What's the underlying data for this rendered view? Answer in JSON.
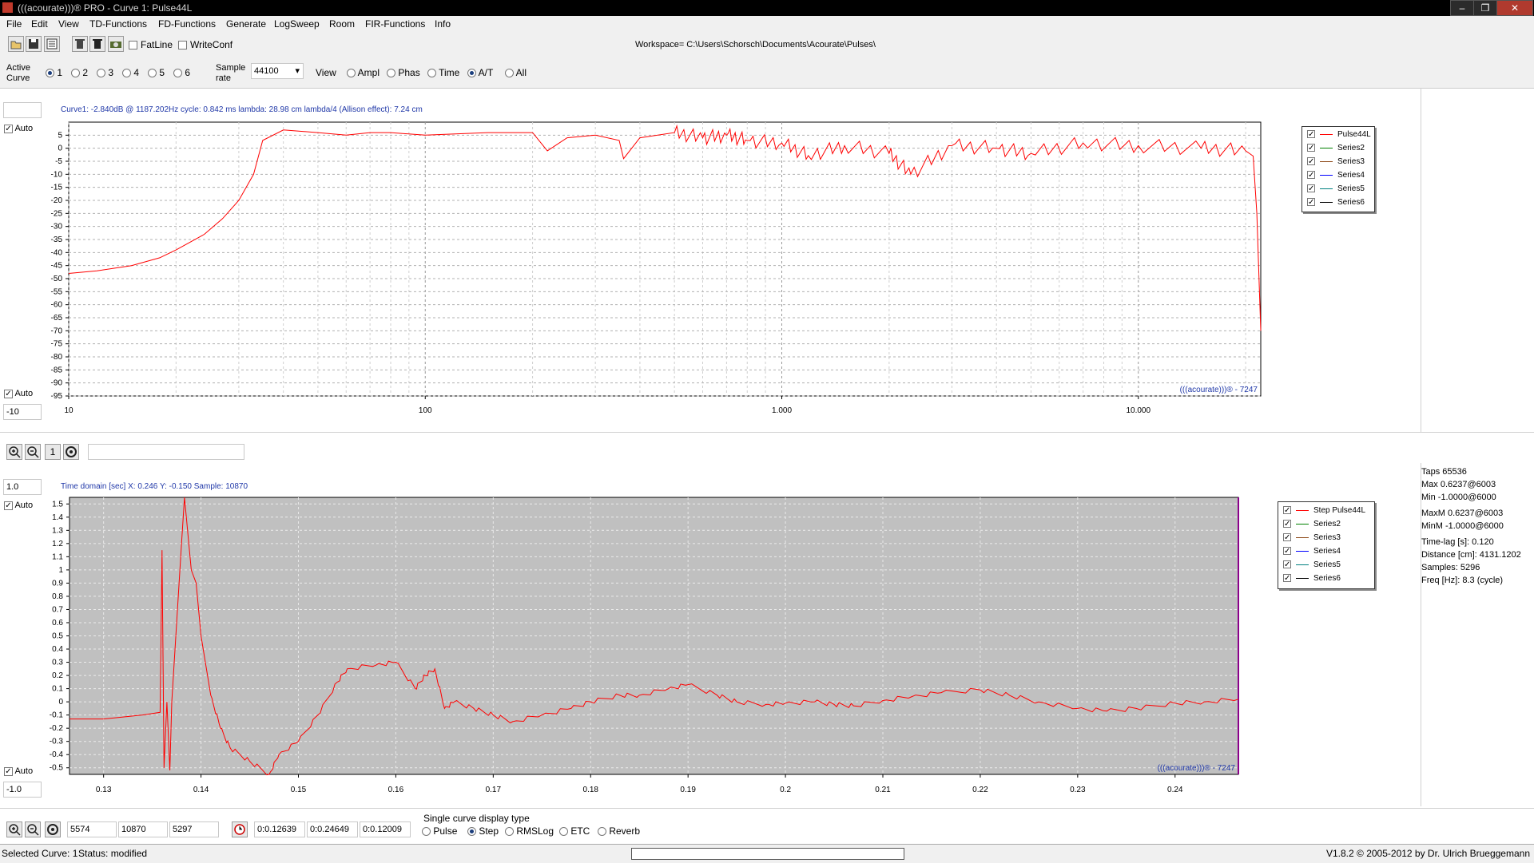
{
  "titlebar": {
    "title": "(((acourate)))® PRO - Curve 1: Pulse44L",
    "min": "–",
    "max": "❐",
    "close": "✕"
  },
  "menu": [
    "File",
    "Edit",
    "View",
    "TD-Functions",
    "FD-Functions",
    "Generate",
    "LogSweep",
    "Room",
    "FIR-Functions",
    "Info"
  ],
  "toolbar": {
    "fatline": "FatLine",
    "writeconf": "WriteConf",
    "workspace": "Workspace= C:\\Users\\Schorsch\\Documents\\Acourate\\Pulses\\"
  },
  "options": {
    "active_curve_label": "Active Curve",
    "curves": [
      "1",
      "2",
      "3",
      "4",
      "5",
      "6"
    ],
    "sample_rate_label": "Sample rate",
    "sample_rate": "44100",
    "view_label": "View",
    "views": [
      "Ampl",
      "Phas",
      "Time",
      "A/T",
      "All"
    ]
  },
  "freq_panel": {
    "info": "Curve1: -2.840dB @ 1187.202Hz   cycle: 0.842 ms   lambda: 28.98 cm   lambda/4 (Allison effect): 7.24 cm",
    "auto_top": "Auto",
    "auto_bottom": "Auto",
    "top_value": "",
    "bottom_value": "-10",
    "watermark": "(((acourate)))® - 7247",
    "legend": [
      "Pulse44L",
      "Series2",
      "Series3",
      "Series4",
      "Series5",
      "Series6"
    ]
  },
  "time_panel": {
    "info": "Time domain [sec]   X: 0.246   Y: -0.150   Sample: 10870",
    "top_value": "1.0",
    "bottom_value": "-1.0",
    "auto_top": "Auto",
    "auto_bottom": "Auto",
    "watermark": "(((acourate)))® - 7247",
    "legend": [
      "Step Pulse44L",
      "Series2",
      "Series3",
      "Series4",
      "Series5",
      "Series6"
    ],
    "zoom_one": "1"
  },
  "stats": [
    "Taps 65536",
    "Max 0.6237@6003",
    "Min -1.0000@6000",
    "MaxM 0.6237@6003",
    "MinM -1.0000@6000",
    "Time-lag [s]: 0.120",
    "Distance [cm]: 4131.1202",
    "Samples:  5296",
    "Freq [Hz]: 8.3 (cycle)"
  ],
  "bottom_controls": {
    "fields": [
      "5574",
      "10870",
      "5297"
    ],
    "times": [
      "0:0.12639",
      "0:0.24649",
      "0:0.12009"
    ],
    "display_type_label": "Single curve display type",
    "display_types": [
      "Pulse",
      "Step",
      "RMSLog",
      "ETC",
      "Reverb"
    ]
  },
  "status": {
    "selected": "Selected Curve: 1",
    "state": "Status: modified",
    "version": "V1.8.2 © 2005-2012 by Dr. Ulrich Brueggemann"
  },
  "colors": {
    "curve": "#ff0000",
    "series2": "#008000",
    "series3": "#8b4513",
    "series4": "#0000ff",
    "series5": "#008080",
    "series6": "#000000",
    "plot2_bg": "#c0c0c0",
    "info_text": "#2038a8"
  },
  "chart_data": [
    {
      "type": "line",
      "title": "",
      "xlabel": "",
      "ylabel": "",
      "xscale": "log",
      "xlim": [
        10,
        22050
      ],
      "ylim": [
        -95,
        10
      ],
      "x_tick_labels": [
        "10",
        "100",
        "1.000",
        "10.000"
      ],
      "y_tick_labels": [
        "5",
        "0",
        "-5",
        "-10",
        "-15",
        "-20",
        "-25",
        "-30",
        "-35",
        "-40",
        "-45",
        "-50",
        "-55",
        "-60",
        "-65",
        "-70",
        "-75",
        "-80",
        "-85",
        "-90",
        "-95"
      ],
      "grid": true,
      "legend": "top-right",
      "series": [
        {
          "name": "Pulse44L",
          "x": [
            10,
            12,
            15,
            18,
            20,
            24,
            27,
            30,
            33,
            35,
            40,
            50,
            60,
            70,
            80,
            100,
            150,
            200,
            220,
            250,
            300,
            350,
            360,
            400,
            500,
            600,
            700,
            800,
            1000,
            1187,
            1500,
            2000,
            2300,
            3000,
            4000,
            5000,
            7000,
            10000,
            15000,
            20000,
            21000,
            21500,
            22050
          ],
          "y": [
            -48,
            -47,
            -45,
            -42,
            -39,
            -33,
            -27,
            -20,
            -10,
            3,
            7,
            6,
            5,
            6,
            6,
            5,
            6,
            6,
            -1,
            4,
            5,
            3,
            -4,
            4,
            6,
            4,
            5,
            3,
            2,
            -2.84,
            1,
            -2,
            -10,
            1,
            0,
            -2,
            2,
            1,
            0,
            -1,
            -3,
            -25,
            -70
          ]
        }
      ]
    },
    {
      "type": "line",
      "title": "",
      "xlabel": "",
      "ylabel": "",
      "xlim": [
        0.1265,
        0.2465
      ],
      "ylim": [
        -0.55,
        1.55
      ],
      "x_tick_labels": [
        "0.13",
        "0.14",
        "0.15",
        "0.16",
        "0.17",
        "0.18",
        "0.19",
        "0.2",
        "0.21",
        "0.22",
        "0.23",
        "0.24"
      ],
      "y_tick_labels": [
        "1.5",
        "1.4",
        "1.3",
        "1.2",
        "1.1",
        "1",
        "0.9",
        "0.8",
        "0.7",
        "0.6",
        "0.5",
        "0.4",
        "0.3",
        "0.2",
        "0.1",
        "0",
        "-0.1",
        "-0.2",
        "-0.3",
        "-0.4",
        "-0.5"
      ],
      "grid": true,
      "legend": "top-right",
      "series": [
        {
          "name": "Step Pulse44L",
          "x": [
            0.1265,
            0.13,
            0.134,
            0.1358,
            0.136,
            0.1362,
            0.1365,
            0.1368,
            0.137,
            0.138,
            0.1383,
            0.139,
            0.1395,
            0.14,
            0.141,
            0.142,
            0.143,
            0.145,
            0.147,
            0.148,
            0.15,
            0.152,
            0.154,
            0.155,
            0.158,
            0.16,
            0.162,
            0.163,
            0.164,
            0.165,
            0.166,
            0.168,
            0.17,
            0.172,
            0.175,
            0.178,
            0.18,
            0.183,
            0.185,
            0.188,
            0.19,
            0.193,
            0.195,
            0.198,
            0.2,
            0.203,
            0.205,
            0.207,
            0.21,
            0.213,
            0.216,
            0.22,
            0.223,
            0.226,
            0.23,
            0.233,
            0.236,
            0.24,
            0.243,
            0.2465
          ],
          "y": [
            -0.13,
            -0.13,
            -0.1,
            -0.08,
            1.15,
            -0.5,
            0.0,
            -0.52,
            0.0,
            1.2,
            1.55,
            1.0,
            0.9,
            0.5,
            0.05,
            -0.2,
            -0.35,
            -0.45,
            -0.55,
            -0.4,
            -0.3,
            -0.1,
            0.15,
            0.25,
            0.28,
            0.3,
            0.1,
            0.2,
            0.25,
            -0.05,
            0.0,
            -0.05,
            -0.1,
            -0.15,
            -0.1,
            -0.05,
            0.0,
            0.05,
            0.05,
            0.1,
            0.13,
            0.05,
            0.0,
            -0.02,
            -0.01,
            0.0,
            -0.02,
            -0.03,
            0.01,
            0.04,
            0.07,
            0.09,
            0.05,
            0.0,
            -0.05,
            -0.07,
            -0.05,
            -0.01,
            0.0,
            0.02
          ]
        }
      ]
    }
  ]
}
